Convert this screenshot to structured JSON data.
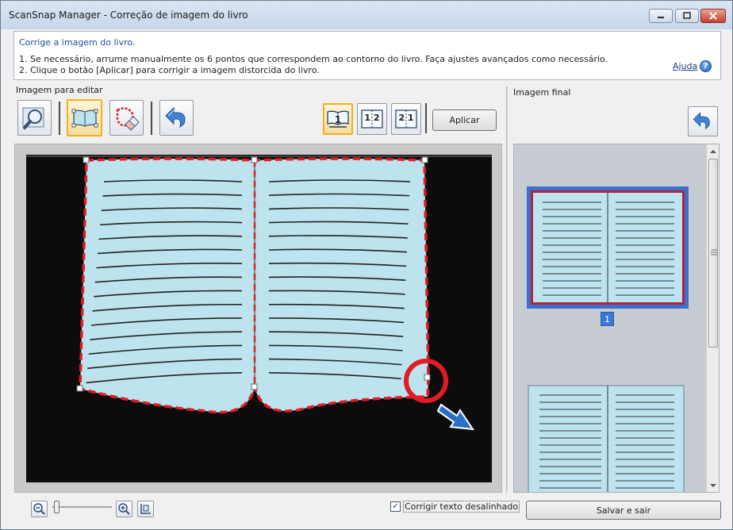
{
  "window": {
    "title": "ScanSnap Manager - Correção de imagem do livro"
  },
  "instructions": {
    "heading": "Corrige a imagem do livro.",
    "line1": "1. Se necessário, arrume manualmente os 6 pontos que correspondem ao contorno do livro. Faça ajustes avançados como necessário.",
    "line2": "2. Clique o botão [Aplicar] para corrigir a imagem distorcida do livro.",
    "help_label": "Ajuda"
  },
  "edit_panel": {
    "label": "Imagem para editar",
    "apply_label": "Aplicar",
    "page_mode_buttons": [
      {
        "label": "1",
        "active": true
      },
      {
        "label": "1 2",
        "active": false
      },
      {
        "label": "2 1",
        "active": false
      }
    ],
    "tools": [
      {
        "icon": "magnifier-icon",
        "active": false
      },
      {
        "icon": "book-points-icon",
        "active": true
      },
      {
        "icon": "eraser-icon",
        "active": false
      },
      {
        "icon": "undo-icon",
        "active": false
      }
    ]
  },
  "final_panel": {
    "label": "Imagem final",
    "page_number": "1"
  },
  "footer": {
    "deskew_label": "Corrigir texto desalinhado",
    "deskew_checked": true,
    "save_label": "Salvar e sair"
  },
  "colors": {
    "page_fill": "#bde3ee",
    "contour": "#e21c24",
    "selected_border": "#f2b01c",
    "page_badge": "#3a78d6"
  }
}
